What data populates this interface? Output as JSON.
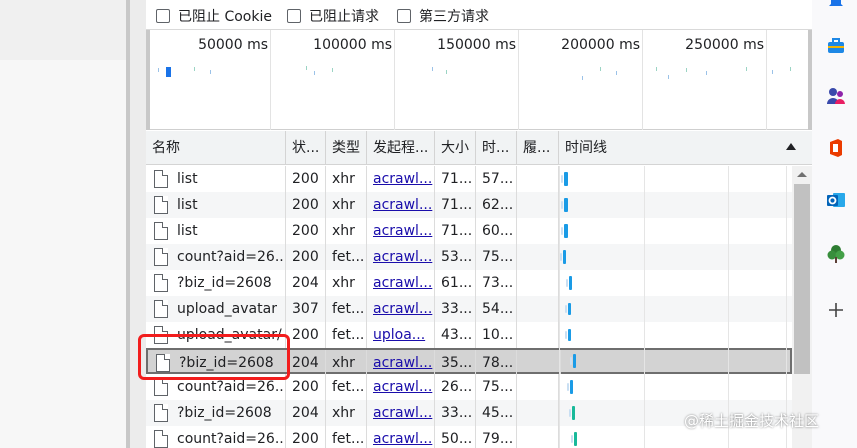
{
  "filters": {
    "blocked_cookies": "已阻止 Cookie",
    "blocked_requests": "已阻止请求",
    "third_party": "第三方请求"
  },
  "overview": {
    "ticks": [
      "50000 ms",
      "100000 ms",
      "150000 ms",
      "200000 ms",
      "250000 ms"
    ]
  },
  "table": {
    "headers": {
      "name": "名称",
      "status": "状...",
      "type": "类型",
      "initiator": "发起程...",
      "size": "大小",
      "time": "时...",
      "fulfilled": "履...",
      "waterfall": "时间线"
    },
    "rows": [
      {
        "name": "list",
        "status": "200",
        "type": "xhr",
        "initiator": "acrawl...",
        "size": "71...",
        "time": "57..."
      },
      {
        "name": "list",
        "status": "200",
        "type": "xhr",
        "initiator": "acrawl...",
        "size": "71...",
        "time": "62..."
      },
      {
        "name": "list",
        "status": "200",
        "type": "xhr",
        "initiator": "acrawl...",
        "size": "71...",
        "time": "60..."
      },
      {
        "name": "count?aid=26...",
        "status": "200",
        "type": "fet...",
        "initiator": "acrawl...",
        "size": "53...",
        "time": "75..."
      },
      {
        "name": "?biz_id=2608",
        "status": "204",
        "type": "xhr",
        "initiator": "acrawl...",
        "size": "61...",
        "time": "73..."
      },
      {
        "name": "upload_avatar",
        "status": "307",
        "type": "fet...",
        "initiator": "acrawl...",
        "size": "33...",
        "time": "54..."
      },
      {
        "name": "upload_avatar/",
        "status": "200",
        "type": "fet...",
        "initiator": "uploa...",
        "size": "43...",
        "time": "10..."
      },
      {
        "name": "?biz_id=2608",
        "status": "204",
        "type": "xhr",
        "initiator": "acrawl...",
        "size": "35...",
        "time": "78..."
      },
      {
        "name": "count?aid=26...",
        "status": "200",
        "type": "fet...",
        "initiator": "acrawl...",
        "size": "26...",
        "time": "75..."
      },
      {
        "name": "?biz_id=2608",
        "status": "204",
        "type": "xhr",
        "initiator": "acrawl...",
        "size": "33...",
        "time": "45..."
      },
      {
        "name": "count?aid=26...",
        "status": "200",
        "type": "fet...",
        "initiator": "acrawl...",
        "size": "50...",
        "time": "79..."
      }
    ],
    "selected_row": 7
  },
  "sidebar": {
    "icons": [
      "bell-icon",
      "briefcase-icon",
      "people-icon",
      "office-icon",
      "outlook-icon",
      "tree-icon",
      "add-icon"
    ]
  },
  "watermark": "@稀土掘金技术社区",
  "colors": {
    "link": "#1a0dab",
    "selected_row": "#d3d3d3",
    "highlight": "#f21d1d",
    "waterfall_blue": "#1a9be6",
    "waterfall_teal": "#18b99a"
  }
}
